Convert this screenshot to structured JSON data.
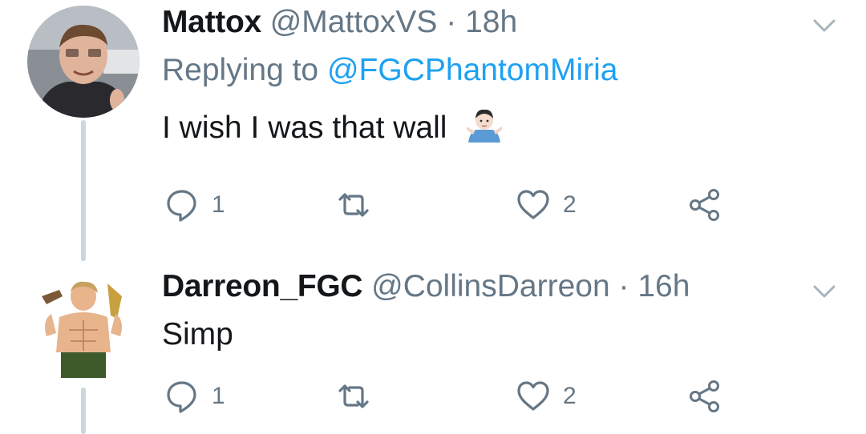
{
  "tweets": [
    {
      "display_name": "Mattox",
      "handle": "@MattoxVS",
      "separator": "·",
      "time": "18h",
      "replying_prefix": "Replying to",
      "replying_to": "@FGCPhantomMiria",
      "text": "I wish I was that wall",
      "emoji": "man-shrugging-emoji",
      "reply_count": "1",
      "retweet_count": "",
      "like_count": "2"
    },
    {
      "display_name": "Darreon_FGC",
      "handle": "@CollinsDarreon",
      "separator": "·",
      "time": "16h",
      "text": "Simp",
      "reply_count": "1",
      "retweet_count": "",
      "like_count": "2"
    }
  ],
  "colors": {
    "text": "#14171a",
    "secondary": "#657786",
    "link": "#1da1f2",
    "thread_line": "#ccd6dd",
    "background": "#ffffff"
  },
  "icons": {
    "reply": "reply-icon",
    "retweet": "retweet-icon",
    "like": "heart-icon",
    "share": "share-icon",
    "menu": "chevron-down-icon"
  }
}
